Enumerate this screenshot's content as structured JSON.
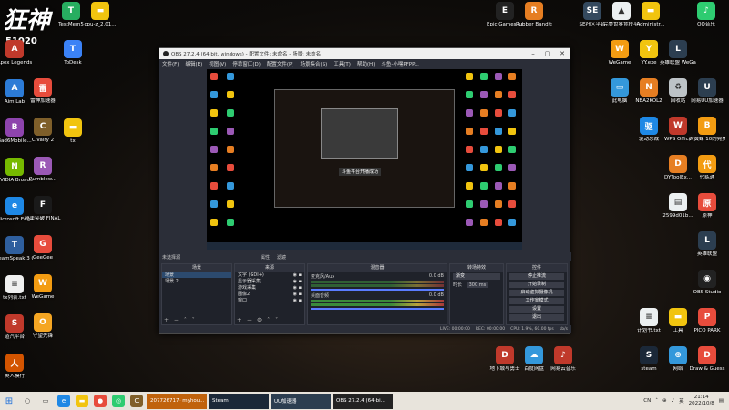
{
  "watermark": {
    "text": "狂神",
    "sub": "51020"
  },
  "desktop_left": [
    {
      "label": "Apex Legends",
      "color": "#c0392b",
      "glyph": "A"
    },
    {
      "label": "Aim Lab",
      "color": "#2c7bd6",
      "glyph": "A"
    },
    {
      "label": "Bad6Mobile...",
      "color": "#8e44ad",
      "glyph": "B"
    },
    {
      "label": "NVIDIA Broadcast",
      "color": "#76b900",
      "glyph": "N"
    },
    {
      "label": "Microsoft Edge",
      "color": "#1e88e5",
      "glyph": "e"
    },
    {
      "label": "TeamSpeak 3 Client",
      "color": "#2f5f9e",
      "glyph": "T"
    },
    {
      "label": "tx列表.txt",
      "color": "#f0f0f0",
      "glyph": "≡"
    },
    {
      "label": "道汽平台",
      "color": "#c0392b",
      "glyph": "S"
    },
    {
      "label": "英人模行",
      "color": "#d35400",
      "glyph": "人"
    }
  ],
  "desktop_col2": [
    {
      "label": "雷神加速器",
      "color": "#e74c3c",
      "glyph": "雷"
    },
    {
      "label": "CiValry 2",
      "color": "#7f5f2a",
      "glyph": "C"
    },
    {
      "label": "Rumblew...",
      "color": "#9b59b6",
      "glyph": "R"
    },
    {
      "label": "超击突破 FINAL BETA",
      "color": "#1a1a1a",
      "glyph": "F"
    },
    {
      "label": "GeeGee",
      "color": "#e74c3c",
      "glyph": "G"
    },
    {
      "label": "WeGame",
      "color": "#f39c12",
      "glyph": "W"
    },
    {
      "label": "守望先锋",
      "color": "#f5a623",
      "glyph": "O"
    }
  ],
  "desktop_col2_extra": [
    {
      "label": "ToDesk",
      "color": "#3b82f6",
      "glyph": "T"
    },
    {
      "label": "tx",
      "color": "#f1c40f",
      "glyph": "▬"
    }
  ],
  "desktop_top": [
    {
      "label": "TestMem5",
      "color": "#27ae60",
      "glyph": "T"
    },
    {
      "label": "cpu-z_2.01...",
      "color": "#f1c40f",
      "glyph": "▬"
    }
  ],
  "desktop_top_right": [
    {
      "label": "Epic Games Launcher",
      "color": "#222",
      "glyph": "E"
    },
    {
      "label": "Rubber Bandits...",
      "color": "#e67e22",
      "glyph": "R"
    },
    {
      "label": "SE社区平台",
      "color": "#34495e",
      "glyph": "SE"
    },
    {
      "label": "完美世界竞技平台",
      "color": "#ecf0f1",
      "glyph": "▲"
    },
    {
      "label": "Administr...",
      "color": "#f1c40f",
      "glyph": "▬"
    },
    {
      "label": "QQ音乐",
      "color": "#2ecc71",
      "glyph": "♪"
    }
  ],
  "desktop_right": [
    {
      "label": "WeGame",
      "color": "#f39c12",
      "glyph": "W"
    },
    {
      "label": "YY.exe",
      "color": "#f1c40f",
      "glyph": "Y"
    },
    {
      "label": "英雄联盟 WeGame版",
      "color": "#2c3e50",
      "glyph": "L"
    },
    {
      "label": "此电脑",
      "color": "#3498db",
      "glyph": "▭"
    },
    {
      "label": "NBA2KOL2",
      "color": "#e67e22",
      "glyph": "N"
    },
    {
      "label": "回收站",
      "color": "#bdc3c7",
      "glyph": "♻"
    },
    {
      "label": "网易UU加速器",
      "color": "#2c3e50",
      "glyph": "U"
    },
    {
      "label": "驱动总裁",
      "color": "#1e88e5",
      "glyph": "驱"
    },
    {
      "label": "WPS Office",
      "color": "#c0392b",
      "glyph": "W"
    },
    {
      "label": "大黄蜂 10的完美...",
      "color": "#f39c12",
      "glyph": "B"
    },
    {
      "label": "DYToolEx...",
      "color": "#e67e22",
      "glyph": "D"
    },
    {
      "label": "代练通",
      "color": "#f39c12",
      "glyph": "代"
    },
    {
      "label": "2599d01b...",
      "color": "#ecf0f1",
      "glyph": "▤"
    },
    {
      "label": "原神",
      "color": "#e74c3c",
      "glyph": "原"
    },
    {
      "label": "英雄联盟",
      "color": "#2c3e50",
      "glyph": "L"
    },
    {
      "label": "OBS Studio",
      "color": "#222",
      "glyph": "◉"
    },
    {
      "label": "计划书.txt",
      "color": "#ecf0f1",
      "glyph": "≡"
    },
    {
      "label": "工具",
      "color": "#f1c40f",
      "glyph": "▬"
    },
    {
      "label": "PICO PARK",
      "color": "#e74c3c",
      "glyph": "P"
    },
    {
      "label": "steam",
      "color": "#1b2838",
      "glyph": "S"
    },
    {
      "label": "网络",
      "color": "#3498db",
      "glyph": "⊕"
    },
    {
      "label": "Draw & Guess",
      "color": "#e74c3c",
      "glyph": "D"
    }
  ],
  "desktop_bottom_mid": [
    {
      "label": "地下城与勇士",
      "color": "#c0392b",
      "glyph": "D"
    },
    {
      "label": "百度网盘",
      "color": "#3498db",
      "glyph": "☁"
    },
    {
      "label": "网易云音乐",
      "color": "#c0392b",
      "glyph": "♪"
    }
  ],
  "obs": {
    "title": "OBS 27.2.4 (64 bit, windows) - 配置文件: 未命名 - 场景: 未命名",
    "menu": [
      "文件(F)",
      "编辑(E)",
      "视图(V)",
      "停靠窗口(D)",
      "配置文件(P)",
      "场景集合(S)",
      "工具(T)",
      "帮助(H)",
      "斗鱼-小嘿PFPP..."
    ],
    "toast": "斗鱼平台开播成功",
    "tools": {
      "source_label": "未选择源",
      "properties": "属性",
      "filters": "滤镜"
    },
    "scenes": {
      "header": "场景",
      "items": [
        "场景",
        "场景 2"
      ]
    },
    "sources": {
      "header": "来源",
      "items": [
        "文字 (GDI+)",
        "显示器采集",
        "游戏采集",
        "图像2",
        "窗口"
      ]
    },
    "mixer": {
      "header": "混音器",
      "ch1_label": "麦克风/Aux",
      "ch1_db": "0.0 dB",
      "ch2_label": "桌面音频",
      "ch2_db": "0.0 dB"
    },
    "transitions": {
      "header": "转场特效",
      "type": "渐变",
      "duration_label": "时长",
      "duration": "300 ms"
    },
    "controls": {
      "header": "控件",
      "buttons": [
        "停止推流",
        "开始录制",
        "启动虚拟摄像机",
        "工作室模式",
        "设置",
        "退出"
      ]
    },
    "status": {
      "live": "LIVE: 00:00:00",
      "rec": "REC: 00:00:00",
      "cpu": "CPU: 1.9%, 60.00 fps",
      "bandwidth": "kb/s"
    }
  },
  "taskbar": {
    "apps": [
      {
        "label": "207726717- myhou...",
        "color": "#c0620c"
      },
      {
        "label": "Steam",
        "color": "#1b2838"
      },
      {
        "label": "UU加速器",
        "color": "#2c3e50"
      },
      {
        "label": "OBS 27.2.4 (64-bi...",
        "color": "#222"
      }
    ],
    "tray": {
      "lang": "CN",
      "ime": "英",
      "time": "21:14",
      "date": "2022/10/8"
    }
  }
}
